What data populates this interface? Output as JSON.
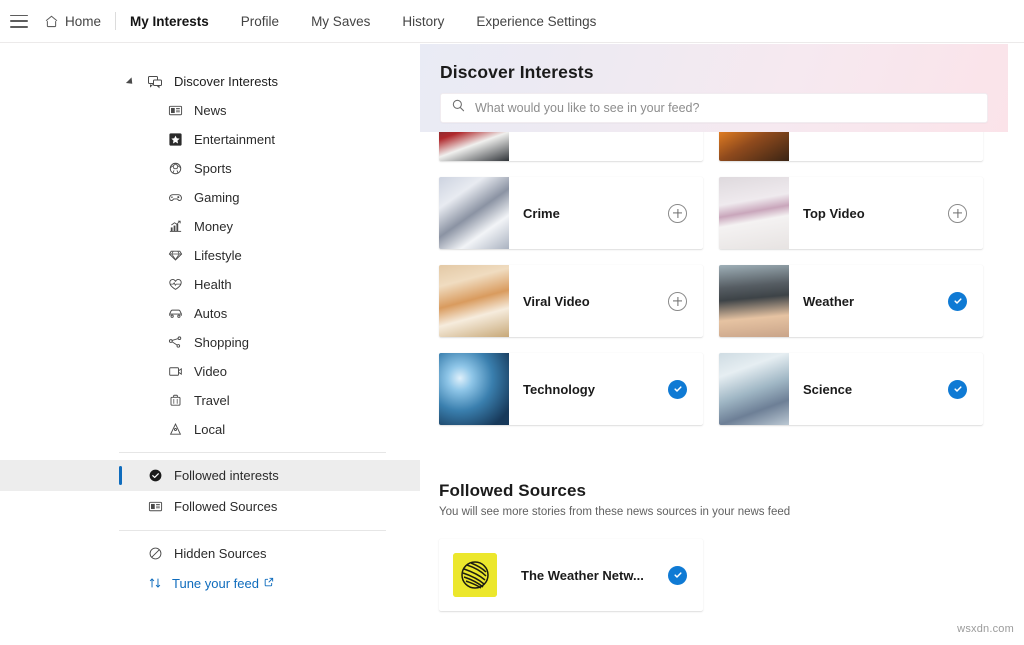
{
  "topnav": {
    "menu_icon": "hamburger-icon",
    "home": {
      "label": "Home",
      "icon": "home-icon"
    },
    "items": [
      {
        "label": "My Interests",
        "active": true
      },
      {
        "label": "Profile",
        "active": false
      },
      {
        "label": "My Saves",
        "active": false
      },
      {
        "label": "History",
        "active": false
      },
      {
        "label": "Experience Settings",
        "active": false
      }
    ]
  },
  "sidebar": {
    "root": {
      "label": "Discover Interests",
      "icon": "discover-interests-icon",
      "expanded": true
    },
    "categories": [
      {
        "label": "News",
        "icon": "news-icon"
      },
      {
        "label": "Entertainment",
        "icon": "star-icon"
      },
      {
        "label": "Sports",
        "icon": "ball-icon"
      },
      {
        "label": "Gaming",
        "icon": "gamepad-icon"
      },
      {
        "label": "Money",
        "icon": "chart-up-icon"
      },
      {
        "label": "Lifestyle",
        "icon": "diamond-icon"
      },
      {
        "label": "Health",
        "icon": "heart-icon"
      },
      {
        "label": "Autos",
        "icon": "car-icon"
      },
      {
        "label": "Shopping",
        "icon": "tag-share-icon"
      },
      {
        "label": "Video",
        "icon": "video-icon"
      },
      {
        "label": "Travel",
        "icon": "suitcase-icon"
      },
      {
        "label": "Local",
        "icon": "location-pin-icon"
      }
    ],
    "followed_interests": {
      "label": "Followed interests",
      "icon": "check-circle-filled-icon",
      "selected": true
    },
    "followed_sources": {
      "label": "Followed Sources",
      "icon": "news-sources-icon",
      "selected": false
    },
    "hidden_sources": {
      "label": "Hidden Sources",
      "icon": "block-circle-icon"
    },
    "tune_feed": {
      "label": "Tune your feed",
      "icon": "sort-arrows-icon",
      "external_icon": "external-link-icon"
    }
  },
  "discover_panel": {
    "title": "Discover Interests",
    "search": {
      "icon": "search-icon",
      "value": "",
      "placeholder": "What would you like to see in your feed?"
    },
    "gradient_from": "#e9ebf5",
    "gradient_to": "#fbe3e9"
  },
  "interest_cards": [
    {
      "name": "",
      "thumb": "t-santa",
      "state": "partial",
      "action_icon": ""
    },
    {
      "name": "",
      "thumb": "t-concert",
      "state": "partial",
      "action_icon": ""
    },
    {
      "name": "Crime",
      "thumb": "t-crime",
      "state": "not-followed",
      "action_icon": "plus-circle-icon"
    },
    {
      "name": "Top Video",
      "thumb": "t-tv",
      "state": "not-followed",
      "action_icon": "plus-circle-icon"
    },
    {
      "name": "Viral Video",
      "thumb": "t-dog",
      "state": "not-followed",
      "action_icon": "plus-circle-icon"
    },
    {
      "name": "Weather",
      "thumb": "t-tornado",
      "state": "followed",
      "action_icon": "check-circle-icon"
    },
    {
      "name": "Technology",
      "thumb": "t-tech",
      "state": "followed",
      "action_icon": "check-circle-icon"
    },
    {
      "name": "Science",
      "thumb": "t-science",
      "state": "followed",
      "action_icon": "check-circle-icon"
    }
  ],
  "followed_sources_section": {
    "title": "Followed Sources",
    "subtitle": "You will see more stories from these news sources in your news feed",
    "sources": [
      {
        "name": "The Weather Netw...",
        "logo": "weather-network-logo",
        "state": "followed",
        "action_icon": "check-circle-icon"
      }
    ]
  },
  "accent_color": "#0f6cbd",
  "check_color": "#0f7ad4",
  "watermark": "wsxdn.com"
}
